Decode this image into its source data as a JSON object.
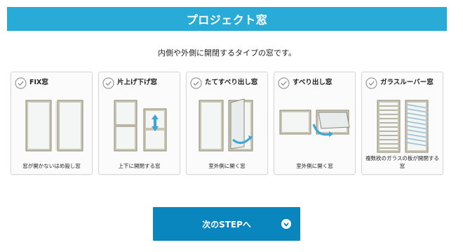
{
  "header": {
    "title": "プロジェクト窓"
  },
  "description": "内側や外側に開閉するタイプの窓です。",
  "icons": {
    "check": "check-circle-icon",
    "next": "arrow-down-circle-icon"
  },
  "colors": {
    "header": "#29abd7",
    "button": "#0a86be"
  },
  "options": [
    {
      "title": "FIX窓",
      "caption": "窓が開かないはめ殺し窓"
    },
    {
      "title": "片上げ下げ窓",
      "caption": "上下に開閉する窓"
    },
    {
      "title": "たてすべり出し窓",
      "caption": "室外側に開く窓"
    },
    {
      "title": "すべり出し窓",
      "caption": "室外側に開く窓"
    },
    {
      "title": "ガラスルーバー窓",
      "caption": "複数枚のガラスの板が開閉する窓"
    }
  ],
  "next_button": {
    "label": "次のSTEPへ"
  }
}
